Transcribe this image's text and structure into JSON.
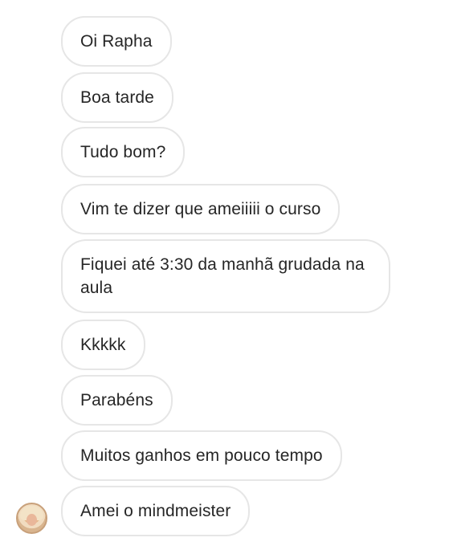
{
  "messages": [
    {
      "text": "Oi Rapha"
    },
    {
      "text": "Boa tarde"
    },
    {
      "text": "Tudo bom?"
    },
    {
      "text": "Vim te dizer que ameiiiii o curso"
    },
    {
      "text": "Fiquei até 3:30 da manhã grudada na aula"
    },
    {
      "text": "Kkkkk"
    },
    {
      "text": "Parabéns"
    },
    {
      "text": "Muitos ganhos em pouco tempo"
    },
    {
      "text": "Amei o mindmeister"
    }
  ],
  "sender": {
    "avatar_icon": "user-avatar"
  },
  "colors": {
    "bubble_border": "#e6e6e6",
    "text": "#262626",
    "background": "#ffffff"
  }
}
